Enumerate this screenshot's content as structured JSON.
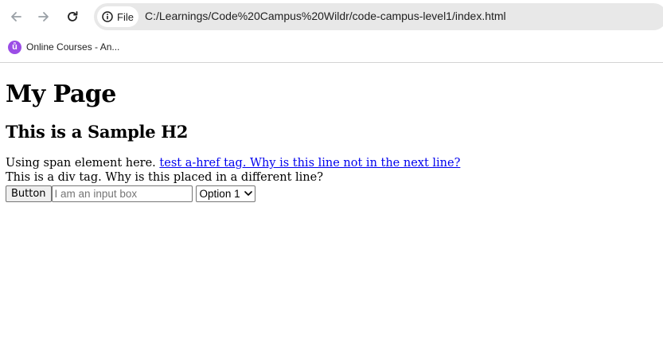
{
  "browser": {
    "site_info_label": "File",
    "url": "C:/Learnings/Code%20Campus%20Wildr/code-campus-level1/index.html",
    "bookmarks": [
      {
        "label": "Online Courses - An..."
      }
    ]
  },
  "page": {
    "h1": "My Page",
    "h2": "This is a Sample H2",
    "span_text": "Using span element here.",
    "link_text": "test a-href tag. Why is this line not in the next line?",
    "div_text": "This is a div tag. Why is this placed in a different line?",
    "button_label": "Button",
    "input_placeholder": "I am an input box",
    "select_value": "Option 1"
  },
  "colors": {
    "link": "#0000ee",
    "omnibox_bg": "#e8e8e8",
    "bookmark_favicon": "#9b4de6"
  }
}
